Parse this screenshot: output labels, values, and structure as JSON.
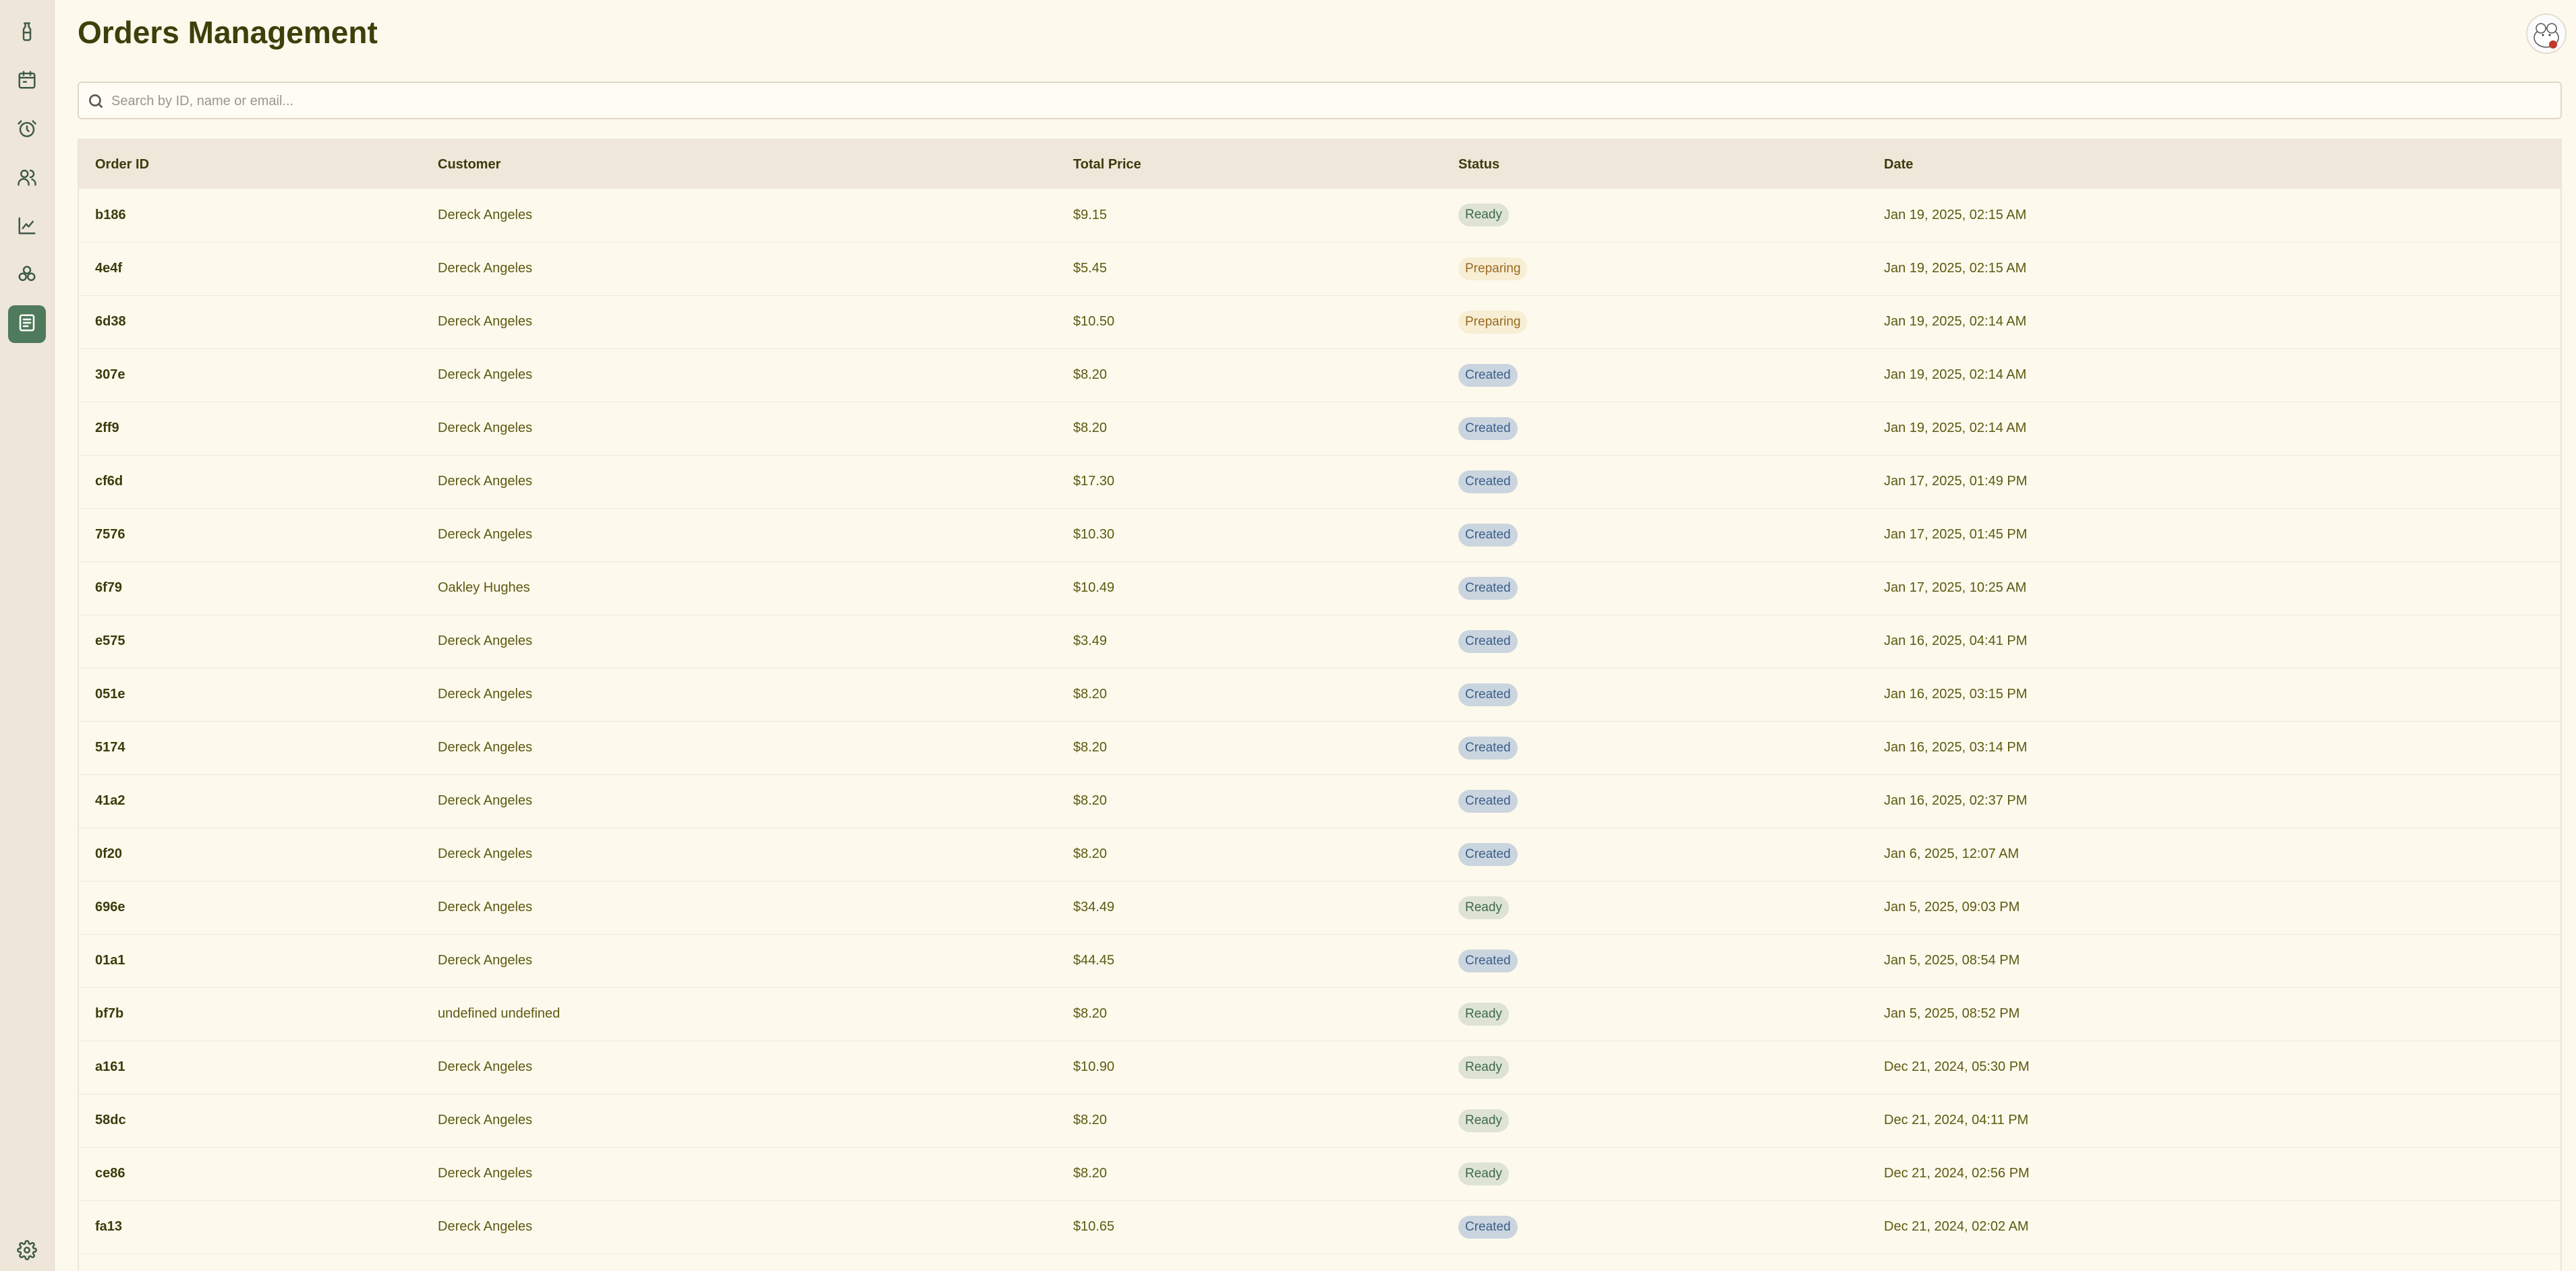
{
  "header": {
    "title": "Orders Management"
  },
  "search": {
    "placeholder": "Search by ID, name or email..."
  },
  "sidebar": {
    "items": [
      {
        "icon": "drink-icon"
      },
      {
        "icon": "calendar-icon"
      },
      {
        "icon": "alarm-clock-icon"
      },
      {
        "icon": "users-icon"
      },
      {
        "icon": "chart-line-icon"
      },
      {
        "icon": "ingredients-icon"
      },
      {
        "icon": "orders-icon",
        "active": true
      }
    ],
    "footer_icon": "settings-icon"
  },
  "table": {
    "columns": [
      "Order ID",
      "Customer",
      "Total Price",
      "Status",
      "Date"
    ],
    "rows": [
      {
        "id": "b186",
        "customer": "Dereck Angeles",
        "total": "$9.15",
        "status": "Ready",
        "date": "Jan 19, 2025, 02:15 AM"
      },
      {
        "id": "4e4f",
        "customer": "Dereck Angeles",
        "total": "$5.45",
        "status": "Preparing",
        "date": "Jan 19, 2025, 02:15 AM"
      },
      {
        "id": "6d38",
        "customer": "Dereck Angeles",
        "total": "$10.50",
        "status": "Preparing",
        "date": "Jan 19, 2025, 02:14 AM"
      },
      {
        "id": "307e",
        "customer": "Dereck Angeles",
        "total": "$8.20",
        "status": "Created",
        "date": "Jan 19, 2025, 02:14 AM"
      },
      {
        "id": "2ff9",
        "customer": "Dereck Angeles",
        "total": "$8.20",
        "status": "Created",
        "date": "Jan 19, 2025, 02:14 AM"
      },
      {
        "id": "cf6d",
        "customer": "Dereck Angeles",
        "total": "$17.30",
        "status": "Created",
        "date": "Jan 17, 2025, 01:49 PM"
      },
      {
        "id": "7576",
        "customer": "Dereck Angeles",
        "total": "$10.30",
        "status": "Created",
        "date": "Jan 17, 2025, 01:45 PM"
      },
      {
        "id": "6f79",
        "customer": "Oakley Hughes",
        "total": "$10.49",
        "status": "Created",
        "date": "Jan 17, 2025, 10:25 AM"
      },
      {
        "id": "e575",
        "customer": "Dereck Angeles",
        "total": "$3.49",
        "status": "Created",
        "date": "Jan 16, 2025, 04:41 PM"
      },
      {
        "id": "051e",
        "customer": "Dereck Angeles",
        "total": "$8.20",
        "status": "Created",
        "date": "Jan 16, 2025, 03:15 PM"
      },
      {
        "id": "5174",
        "customer": "Dereck Angeles",
        "total": "$8.20",
        "status": "Created",
        "date": "Jan 16, 2025, 03:14 PM"
      },
      {
        "id": "41a2",
        "customer": "Dereck Angeles",
        "total": "$8.20",
        "status": "Created",
        "date": "Jan 16, 2025, 02:37 PM"
      },
      {
        "id": "0f20",
        "customer": "Dereck Angeles",
        "total": "$8.20",
        "status": "Created",
        "date": "Jan 6, 2025, 12:07 AM"
      },
      {
        "id": "696e",
        "customer": "Dereck Angeles",
        "total": "$34.49",
        "status": "Ready",
        "date": "Jan 5, 2025, 09:03 PM"
      },
      {
        "id": "01a1",
        "customer": "Dereck Angeles",
        "total": "$44.45",
        "status": "Created",
        "date": "Jan 5, 2025, 08:54 PM"
      },
      {
        "id": "bf7b",
        "customer": "undefined undefined",
        "total": "$8.20",
        "status": "Ready",
        "date": "Jan 5, 2025, 08:52 PM"
      },
      {
        "id": "a161",
        "customer": "Dereck Angeles",
        "total": "$10.90",
        "status": "Ready",
        "date": "Dec 21, 2024, 05:30 PM"
      },
      {
        "id": "58dc",
        "customer": "Dereck Angeles",
        "total": "$8.20",
        "status": "Ready",
        "date": "Dec 21, 2024, 04:11 PM"
      },
      {
        "id": "ce86",
        "customer": "Dereck Angeles",
        "total": "$8.20",
        "status": "Ready",
        "date": "Dec 21, 2024, 02:56 PM"
      },
      {
        "id": "fa13",
        "customer": "Dereck Angeles",
        "total": "$10.65",
        "status": "Created",
        "date": "Dec 21, 2024, 02:02 AM"
      }
    ]
  },
  "colors": {
    "background": "#fdf9ec",
    "sidebar": "#eee6d9",
    "accent": "#4f7a5c",
    "status_ready": "#3e6b48",
    "status_preparing": "#9a6a22",
    "status_created": "#3b5f8a"
  }
}
